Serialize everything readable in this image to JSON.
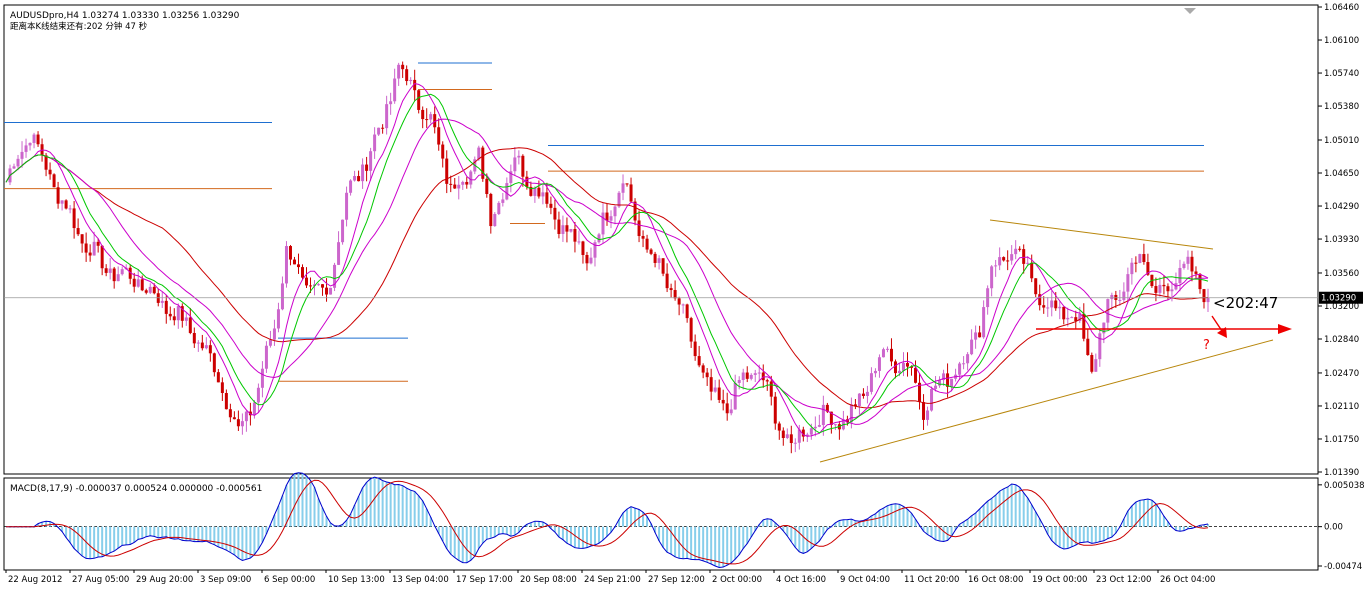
{
  "main_title": "AUDUSDpro,H4  1.03274 1.03330 1.03256 1.03290",
  "countdown_text": "距离本K线结束还有:202 分钟 47 秒",
  "macd_title": "MACD(8,17,9) -0.000037 0.000524 0.000000 -0.000561",
  "timer_label": "<202:47",
  "question_mark": "?",
  "current_price_label": "1.03290",
  "colors": {
    "bull_body": "#cc66cc",
    "bear_body": "#cc0000",
    "green_ma": "#00c800",
    "magenta_ma": "#cc00cc",
    "red_ma": "#cc0000",
    "blue_level": "#1e6fd0",
    "orange_level": "#d2691e",
    "trendline": "#b8860b",
    "macd_hist": "#87ceeb",
    "macd_line": "#0000cc",
    "signal_line": "#cc0000",
    "arrow": "#ee0000"
  },
  "chart_data": [
    {
      "type": "candlestick",
      "title": "AUDUSDpro,H4",
      "ylim": [
        1.0139,
        1.0646
      ],
      "price_ticks": [
        "1.06460",
        "1.06100",
        "1.05740",
        "1.05380",
        "1.05010",
        "1.04650",
        "1.04290",
        "1.03930",
        "1.03560",
        "1.03200",
        "1.02840",
        "1.02470",
        "1.02110",
        "1.01750",
        "1.01390"
      ],
      "x_ticks": [
        "22 Aug 2012",
        "27 Aug 05:00",
        "29 Aug 20:00",
        "3 Sep 09:00",
        "6 Sep 00:00",
        "10 Sep 13:00",
        "13 Sep 04:00",
        "17 Sep 17:00",
        "20 Sep 08:00",
        "24 Sep 21:00",
        "27 Sep 12:00",
        "2 Oct 00:00",
        "4 Oct 16:00",
        "9 Oct 04:00",
        "11 Oct 20:00",
        "16 Oct 08:00",
        "19 Oct 00:00",
        "23 Oct 12:00",
        "26 Oct 04:00"
      ],
      "last_price": 1.0329,
      "approx_close_path": [
        [
          0,
          1.0455
        ],
        [
          6,
          1.051
        ],
        [
          10,
          1.047
        ],
        [
          18,
          1.04
        ],
        [
          25,
          1.036
        ],
        [
          32,
          1.035
        ],
        [
          40,
          1.032
        ],
        [
          47,
          1.029
        ],
        [
          53,
          1.0245
        ],
        [
          58,
          1.018
        ],
        [
          63,
          1.023
        ],
        [
          67,
          1.03
        ],
        [
          70,
          1.038
        ],
        [
          75,
          1.034
        ],
        [
          80,
          1.033
        ],
        [
          85,
          1.044
        ],
        [
          90,
          1.048
        ],
        [
          94,
          1.052
        ],
        [
          98,
          1.058
        ],
        [
          101,
          1.056
        ],
        [
          106,
          1.052
        ],
        [
          111,
          1.045
        ],
        [
          115,
          1.046
        ],
        [
          118,
          1.049
        ],
        [
          121,
          1.041
        ],
        [
          124,
          1.045
        ],
        [
          127,
          1.048
        ],
        [
          130,
          1.046
        ],
        [
          134,
          1.044
        ],
        [
          140,
          1.04
        ],
        [
          145,
          1.037
        ],
        [
          150,
          1.042
        ],
        [
          154,
          1.046
        ],
        [
          158,
          1.04
        ],
        [
          163,
          1.036
        ],
        [
          168,
          1.032
        ],
        [
          172,
          1.027
        ],
        [
          176,
          1.022
        ],
        [
          180,
          1.021
        ],
        [
          184,
          1.024
        ],
        [
          188,
          1.025
        ],
        [
          192,
          1.02
        ],
        [
          196,
          1.0165
        ],
        [
          200,
          1.019
        ],
        [
          205,
          1.02
        ],
        [
          210,
          1.0195
        ],
        [
          214,
          1.0225
        ],
        [
          219,
          1.027
        ],
        [
          222,
          1.026
        ],
        [
          226,
          1.025
        ],
        [
          229,
          1.021
        ],
        [
          234,
          1.024
        ],
        [
          239,
          1.026
        ],
        [
          243,
          1.03
        ],
        [
          246,
          1.036
        ],
        [
          250,
          1.038
        ],
        [
          255,
          1.036
        ],
        [
          259,
          1.032
        ],
        [
          264,
          1.0315
        ],
        [
          268,
          1.03
        ],
        [
          271,
          1.025
        ],
        [
          275,
          1.032
        ],
        [
          279,
          1.034
        ],
        [
          283,
          1.038
        ],
        [
          287,
          1.033
        ],
        [
          291,
          1.035
        ],
        [
          295,
          1.036
        ],
        [
          298,
          1.0345
        ],
        [
          300,
          1.0329
        ]
      ],
      "overlays": [
        {
          "name": "fast MA",
          "color": "#00c800"
        },
        {
          "name": "medium MA",
          "color": "#cc00cc"
        },
        {
          "name": "slow MA",
          "color": "#cc00cc"
        },
        {
          "name": "long MA",
          "color": "#cc0000"
        }
      ],
      "annotations": [
        "horizontal support/resistance levels (blue and orange)",
        "descending upper trendline",
        "ascending lower trendline",
        "red arrow right",
        "red arrow down-right",
        "?"
      ]
    },
    {
      "type": "bar",
      "title": "MACD(8,17,9)",
      "ylim": [
        -0.00474,
        0.00538
      ],
      "price_ticks": [
        "0.005038",
        "0.00",
        "-0.00474"
      ],
      "values_note": "histogram oscillates around zero with MACD and signal lines"
    }
  ]
}
